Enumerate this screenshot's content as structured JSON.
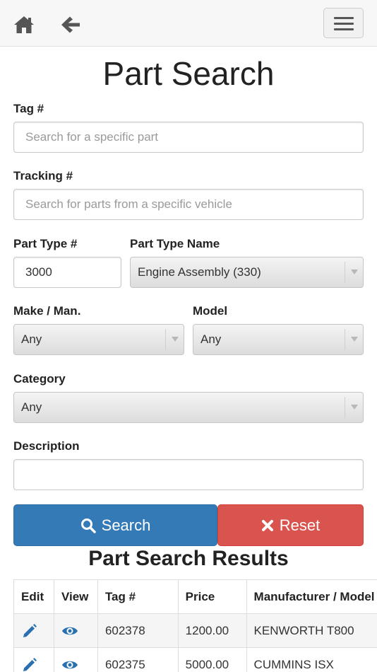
{
  "nav": {
    "home_icon": "home-icon",
    "back_icon": "arrow-left-icon",
    "menu_icon": "hamburger-menu-icon"
  },
  "page": {
    "title": "Part Search"
  },
  "form": {
    "tag": {
      "label": "Tag #",
      "placeholder": "Search for a specific part",
      "value": ""
    },
    "tracking": {
      "label": "Tracking #",
      "placeholder": "Search for parts from a specific vehicle",
      "value": ""
    },
    "part_type_num": {
      "label": "Part Type #",
      "value": "3000"
    },
    "part_type_name": {
      "label": "Part Type Name",
      "value": "Engine Assembly (330)"
    },
    "make": {
      "label": "Make / Man.",
      "value": "Any"
    },
    "model": {
      "label": "Model",
      "value": "Any"
    },
    "category": {
      "label": "Category",
      "value": "Any"
    },
    "description": {
      "label": "Description",
      "value": ""
    },
    "search_label": "Search",
    "reset_label": "Reset"
  },
  "results": {
    "title": "Part Search Results",
    "columns": [
      "Edit",
      "View",
      "Tag #",
      "Price",
      "Manufacturer / Model"
    ],
    "rows": [
      {
        "tag": "602378",
        "price": "1200.00",
        "manufacturer": "KENWORTH T800"
      },
      {
        "tag": "602375",
        "price": "5000.00",
        "manufacturer": "CUMMINS ISX"
      }
    ]
  },
  "colors": {
    "primary": "#337ab7",
    "danger": "#d9534f",
    "icon": "#555555",
    "row_icon": "#2a6fb0"
  }
}
